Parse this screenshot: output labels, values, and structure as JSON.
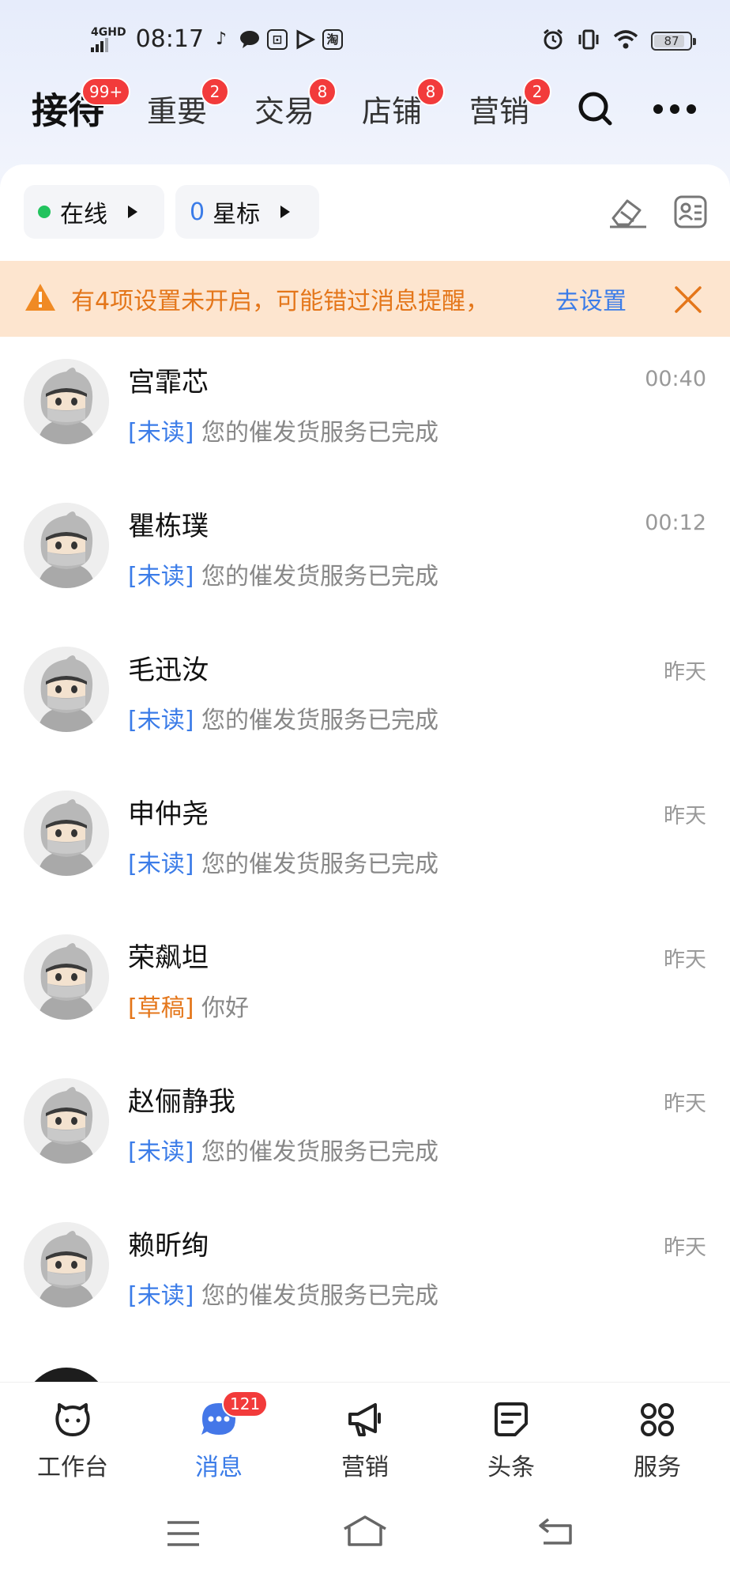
{
  "status_bar": {
    "network": "4GHD",
    "time": "08:17",
    "app_icons": [
      "tiktok-icon",
      "chat-bubble-icon",
      "square-app-icon",
      "play-app-icon",
      "taobao-icon"
    ],
    "app_box_label": "淘",
    "battery": "87"
  },
  "top_tabs": [
    {
      "label": "接待",
      "badge": "99+"
    },
    {
      "label": "重要",
      "badge": "2"
    },
    {
      "label": "交易",
      "badge": "8"
    },
    {
      "label": "店铺",
      "badge": "8"
    },
    {
      "label": "营销",
      "badge": "2"
    }
  ],
  "filters": {
    "online_label": "在线",
    "star_count": "0",
    "star_label": "星标"
  },
  "notice": {
    "text": "有4项设置未开启，可能错过消息提醒，",
    "link": "去设置"
  },
  "conversations": [
    {
      "name": "宫霏芯",
      "time": "00:40",
      "tag": "[未读]",
      "tag_type": "unread",
      "preview": "您的催发货服务已完成"
    },
    {
      "name": "瞿栋璞",
      "time": "00:12",
      "tag": "[未读]",
      "tag_type": "unread",
      "preview": "您的催发货服务已完成"
    },
    {
      "name": "毛迅汝",
      "time": "昨天",
      "tag": "[未读]",
      "tag_type": "unread",
      "preview": "您的催发货服务已完成"
    },
    {
      "name": "申仲尧",
      "time": "昨天",
      "tag": "[未读]",
      "tag_type": "unread",
      "preview": "您的催发货服务已完成"
    },
    {
      "name": "荣飙坦",
      "time": "昨天",
      "tag": "[草稿]",
      "tag_type": "draft",
      "preview": "你好"
    },
    {
      "name": "赵俪静我",
      "time": "昨天",
      "tag": "[未读]",
      "tag_type": "unread",
      "preview": "您的催发货服务已完成"
    },
    {
      "name": "赖昕绚",
      "time": "昨天",
      "tag": "[未读]",
      "tag_type": "unread",
      "preview": "您的催发货服务已完成"
    }
  ],
  "bottom_nav": [
    {
      "label": "工作台",
      "icon": "workbench-icon"
    },
    {
      "label": "消息",
      "icon": "message-icon",
      "badge": "121",
      "active": true
    },
    {
      "label": "营销",
      "icon": "megaphone-icon"
    },
    {
      "label": "头条",
      "icon": "headline-icon"
    },
    {
      "label": "服务",
      "icon": "services-grid-icon"
    }
  ],
  "colors": {
    "accent": "#3b7ce8",
    "badge": "#f23b3b",
    "warning": "#e4761a",
    "notice_bg": "#fde5cf",
    "online": "#22c35e"
  }
}
